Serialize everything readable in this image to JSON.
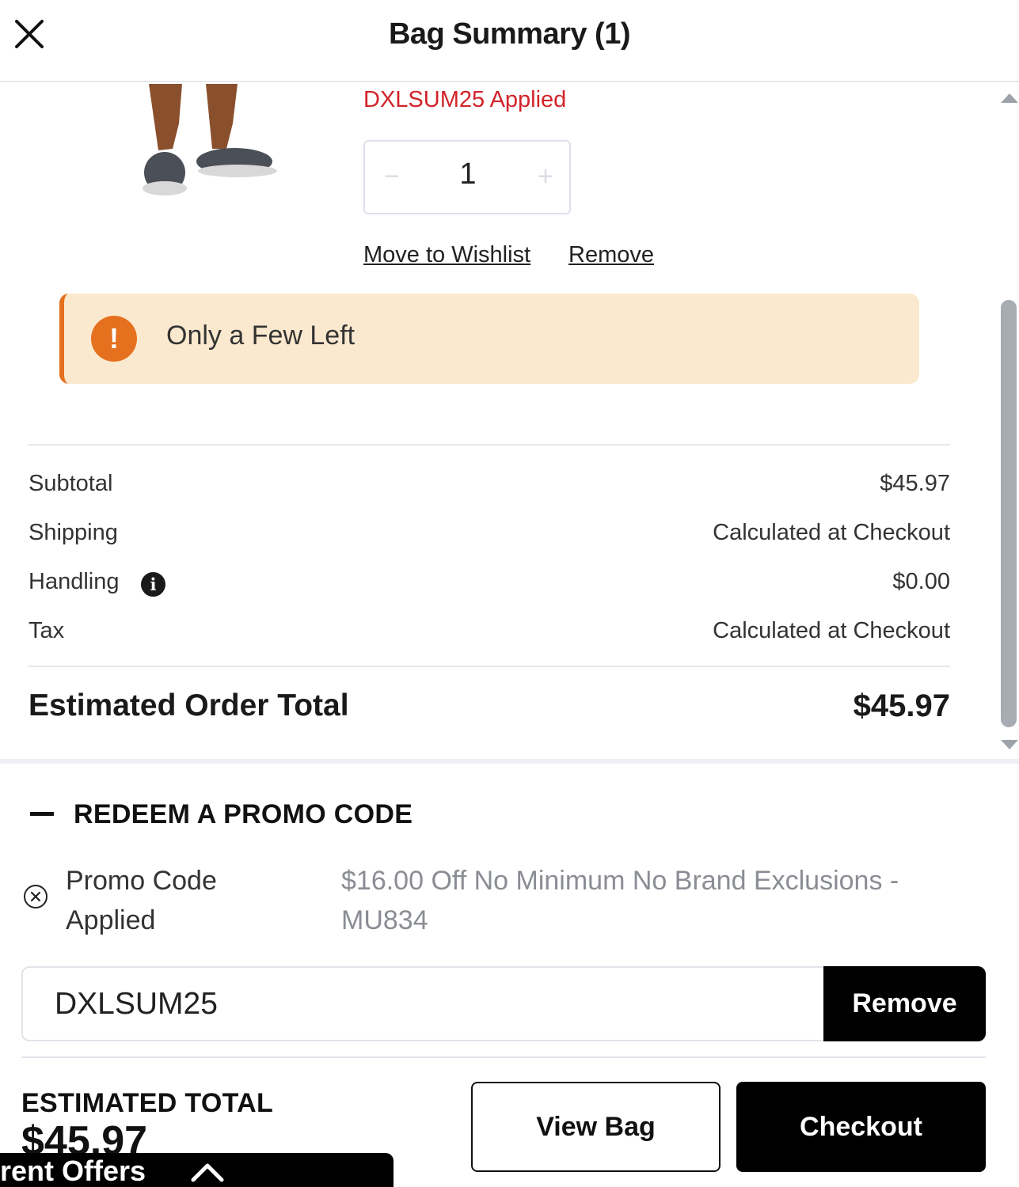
{
  "header": {
    "title": "Bag Summary (1)"
  },
  "item": {
    "promo_applied": "DXLSUM25 Applied",
    "quantity": "1",
    "qty_minus": "−",
    "qty_plus": "+",
    "move_to_wishlist": "Move to Wishlist",
    "remove": "Remove",
    "stock_alert": "Only a Few Left",
    "stock_alert_icon": "!"
  },
  "summary": {
    "rows": [
      {
        "label": "Subtotal",
        "value": "$45.97"
      },
      {
        "label": "Shipping",
        "value": "Calculated at Checkout"
      },
      {
        "label": "Handling",
        "value": "$0.00",
        "info_icon": "i"
      },
      {
        "label": "Tax",
        "value": "Calculated at Checkout"
      }
    ],
    "estimated_label": "Estimated Order Total",
    "estimated_value": "$45.97"
  },
  "promo": {
    "heading": "REDEEM A PROMO CODE",
    "applied_label": "Promo Code Applied",
    "applied_desc": "$16.00 Off No Minimum No Brand Exclusions - MU834",
    "code_value": "DXLSUM25",
    "remove_button": "Remove"
  },
  "footer": {
    "total_label": "ESTIMATED TOTAL",
    "total_value": "$45.97",
    "view_bag": "View Bag",
    "checkout": "Checkout",
    "offers_label": "rrent Offers"
  },
  "icons": {
    "close": "close-icon",
    "alert": "exclamation-icon",
    "info": "info-icon",
    "collapse": "minus-icon",
    "remove_promo": "circle-x-icon",
    "chevron": "chevron-up-icon"
  },
  "colors": {
    "promo_red": "#d2232a",
    "alert_bg": "#fbe9cf",
    "alert_accent": "#e5701e",
    "primary_button": "#000000"
  }
}
